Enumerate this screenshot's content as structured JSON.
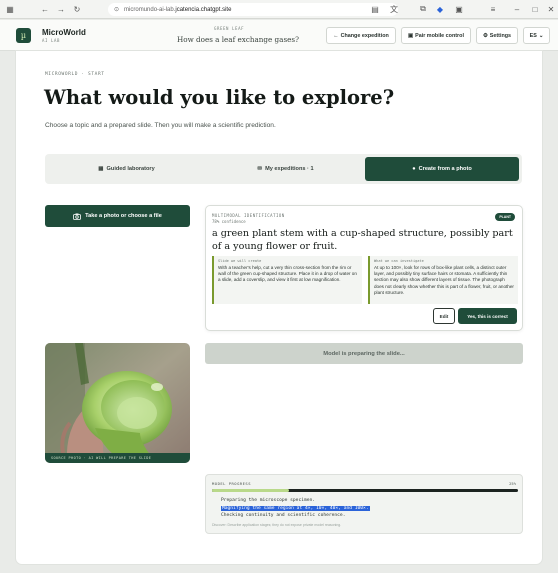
{
  "browser": {
    "url_domain": "micromundo-ai-lab.",
    "url_path": "jcatencia.chatgpt.site"
  },
  "header": {
    "brand": "MicroWorld",
    "brand_sub": "AI LAB",
    "logo_glyph": "µ",
    "eyebrow": "GREEN LEAF",
    "question": "How does a leaf exchange gases?",
    "buttons": {
      "change_expedition": "Change expedition",
      "pair_mobile": "Pair mobile control",
      "settings": "Settings",
      "language": "ES"
    }
  },
  "main": {
    "eyebrow": "MICROWORLD · START",
    "title": "What would you like to explore?",
    "intro": "Choose a topic and a prepared slide. Then you will make a scientific prediction.",
    "tabs": [
      {
        "label": "Guided laboratory",
        "icon": "▦",
        "active": false
      },
      {
        "label": "My expeditions · 1",
        "icon": "✉",
        "active": false
      },
      {
        "label": "Create from a photo",
        "icon": "●",
        "active": true
      }
    ],
    "photo_button": "Take a photo or choose a file"
  },
  "identification": {
    "eyebrow": "MULTIMODAL IDENTIFICATION",
    "confidence": "78% confidence",
    "badge": "PLANT",
    "title": "a green plant stem with a cup-shaped structure, possibly part of a young flower or fruit.",
    "col1_head": "Slide we will create",
    "col1_text": "With a teacher's help, cut a very thin cross-section from the rim or wall of the green cup-shaped structure. Place it in a drop of water on a slide, add a coverslip, and view it first at low magnification.",
    "col2_head": "What we can investigate",
    "col2_text": "At up to 100×, look for rows of box-like plant cells, a distinct outer layer, and possibly tiny surface hairs or stomata. A sufficiently thin section may also show different layers of tissue. The photograph does not clearly show whether this is part of a flower, fruit, or another plant structure.",
    "edit": "Edit",
    "confirm": "Yes, this is correct"
  },
  "photo": {
    "caption": "SOURCE PHOTO · AI WILL PREPARE THE SLIDE"
  },
  "preparing": "Model is preparing the slide...",
  "progress": {
    "label": "MODEL PROGRESS",
    "percent_text": "25%",
    "percent": 0.25,
    "lines": [
      "Preparing the microscope specimen.",
      "Magnifying the same region at 4×, 10×, 40×, and 100×.",
      "Checking continuity and scientific coherence."
    ],
    "note": "Discover: Describe application stages; they do not expose private model reasoning."
  },
  "colors": {
    "accent": "#1f4c3a",
    "progress_fill": "#b9d98a",
    "highlight": "#2b63d9"
  }
}
